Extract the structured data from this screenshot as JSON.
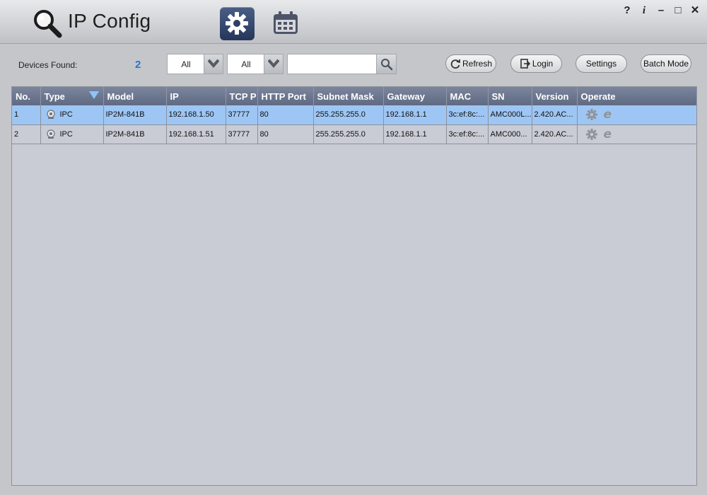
{
  "app": {
    "title": "IP Config"
  },
  "window_controls": {
    "help": "?",
    "info": "i",
    "minimize": "–",
    "maximize": "□",
    "close": "✕"
  },
  "toolbar": {
    "devices_found_label": "Devices Found:",
    "devices_found_count": "2",
    "filter1_value": "All",
    "filter2_value": "All",
    "search_value": "",
    "refresh_label": "Refresh",
    "login_label": "Login",
    "settings_label": "Settings",
    "batch_mode_label": "Batch Mode"
  },
  "table": {
    "headers": [
      "No.",
      "Type",
      "Model",
      "IP",
      "TCP P",
      "HTTP Port",
      "Subnet Mask",
      "Gateway",
      "MAC",
      "SN",
      "Version",
      "Operate"
    ],
    "rows": [
      {
        "no": "1",
        "type": "IPC",
        "model": "IP2M-841B",
        "ip": "192.168.1.50",
        "tcp": "37777",
        "http": "80",
        "subnet": "255.255.255.0",
        "gateway": "192.168.1.1",
        "mac": "3c:ef:8c:...",
        "sn": "AMC000L...",
        "version": "2.420.AC...",
        "selected": true
      },
      {
        "no": "2",
        "type": "IPC",
        "model": "IP2M-841B",
        "ip": "192.168.1.51",
        "tcp": "37777",
        "http": "80",
        "subnet": "255.255.255.0",
        "gateway": "192.168.1.1",
        "mac": "3c:ef:8c:...",
        "sn": "AMC000...",
        "version": "2.420.AC...",
        "selected": false
      }
    ]
  },
  "colors": {
    "accent_count": "#2a74c9",
    "selected_row": "#9ec6f4",
    "header_bg": "#6b7590"
  },
  "icons": [
    "search-icon",
    "gear-icon",
    "calendar-icon",
    "chevron-down-icon",
    "refresh-icon",
    "login-icon",
    "camera-icon",
    "ie-icon"
  ]
}
